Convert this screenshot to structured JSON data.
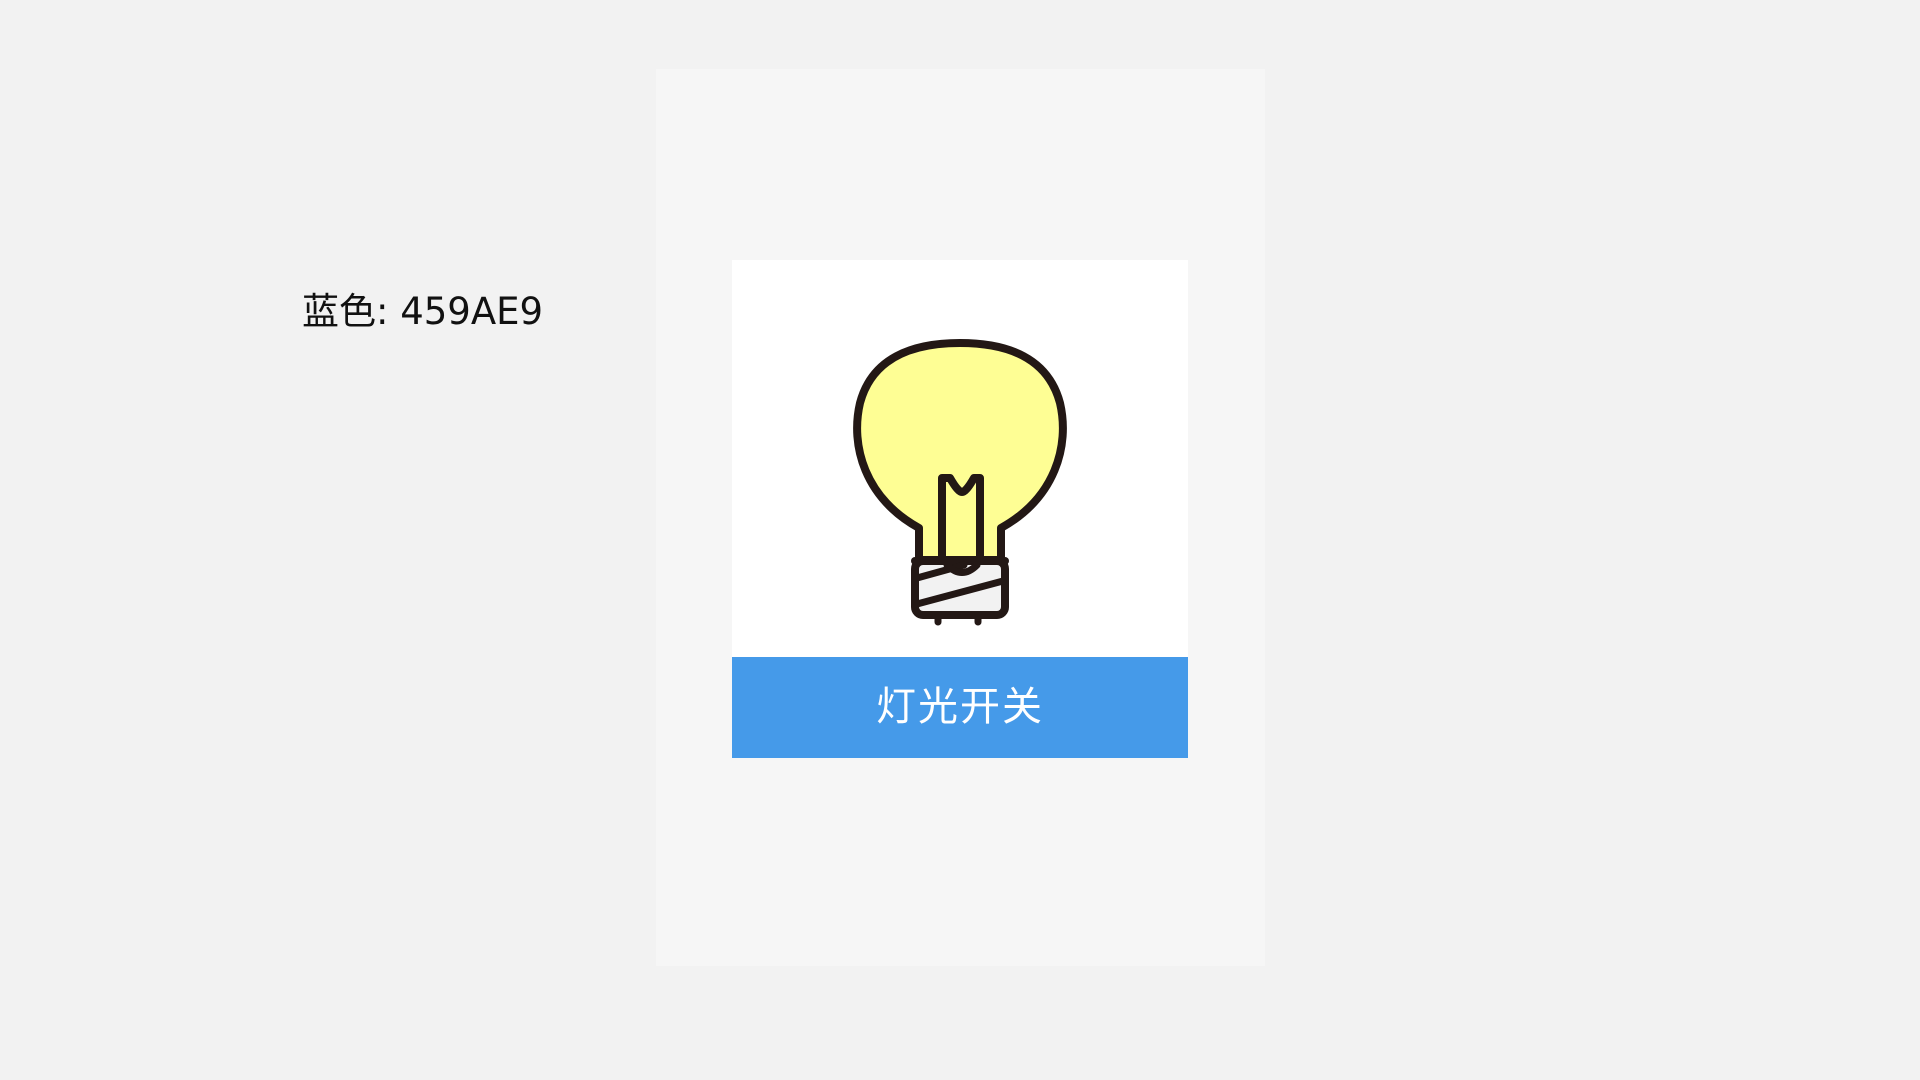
{
  "colors": {
    "page_background": "#f2f2f2",
    "panel_background": "#f6f6f6",
    "card_background": "#ffffff",
    "accent_blue": "#459AE9",
    "button_text": "#ffffff",
    "bulb_fill": "#fefe94",
    "bulb_outline": "#231815",
    "base_fill": "#f2f2f2"
  },
  "note": {
    "text": "蓝色: 459AE9"
  },
  "card": {
    "icon": "light-bulb-icon",
    "button_label": "灯光开关"
  }
}
